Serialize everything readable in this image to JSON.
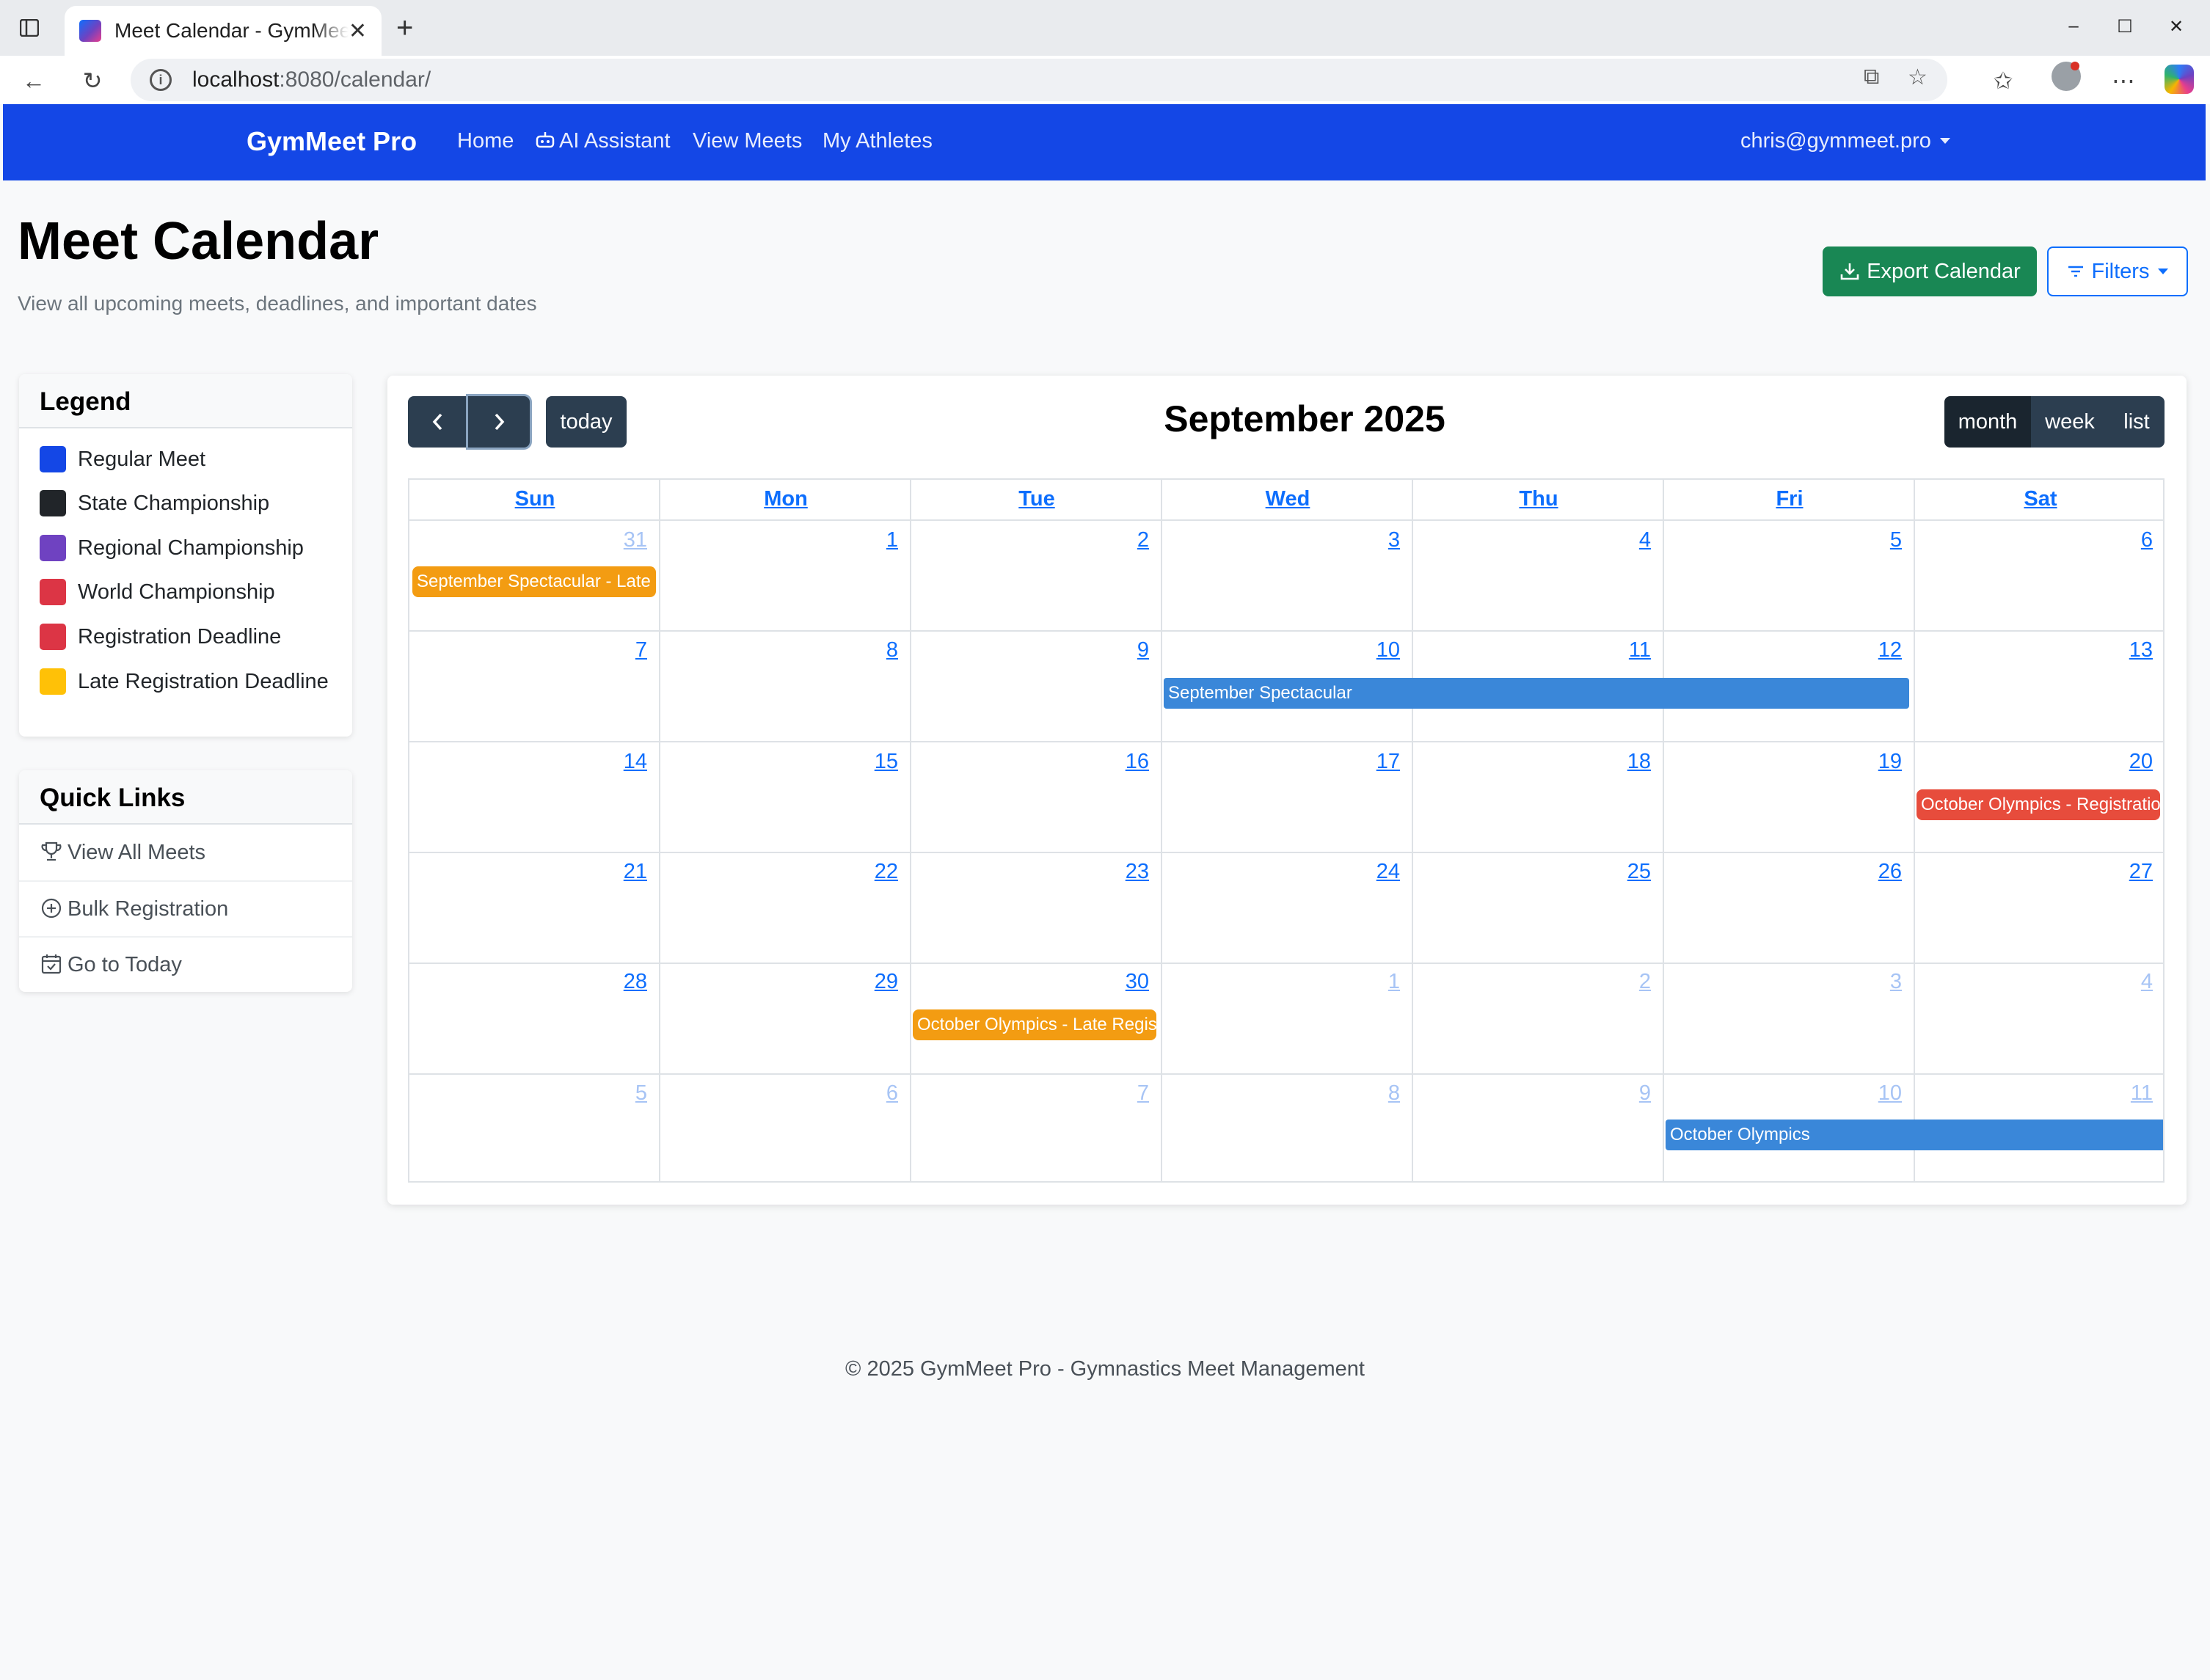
{
  "browser": {
    "tab_title": "Meet Calendar - GymMeet Pro",
    "url_host": "localhost",
    "url_path": ":8080/calendar/"
  },
  "navbar": {
    "brand": "GymMeet Pro",
    "links": {
      "home": "Home",
      "ai_assistant": "AI Assistant",
      "view_meets": "View Meets",
      "my_athletes": "My Athletes"
    },
    "user": "chris@gymmeet.pro"
  },
  "header": {
    "title": "Meet Calendar",
    "subtitle": "View all upcoming meets, deadlines, and important dates",
    "export_label": "Export Calendar",
    "filters_label": "Filters"
  },
  "legend": {
    "title": "Legend",
    "items": [
      {
        "label": "Regular Meet",
        "color": "#1447e6"
      },
      {
        "label": "State Championship",
        "color": "#212529"
      },
      {
        "label": "Regional Championship",
        "color": "#6f42c1"
      },
      {
        "label": "World Championship",
        "color": "#dc3545"
      },
      {
        "label": "Registration Deadline",
        "color": "#dc3545"
      },
      {
        "label": "Late Registration Deadline",
        "color": "#ffc107"
      }
    ]
  },
  "quick_links": {
    "title": "Quick Links",
    "items": [
      {
        "label": "View All Meets",
        "icon": "trophy-icon"
      },
      {
        "label": "Bulk Registration",
        "icon": "plus-circle-icon"
      },
      {
        "label": "Go to Today",
        "icon": "calendar-check-icon"
      }
    ]
  },
  "calendar": {
    "title": "September 2025",
    "today_label": "today",
    "views": {
      "month": "month",
      "week": "week",
      "list": "list"
    },
    "weekdays": [
      "Sun",
      "Mon",
      "Tue",
      "Wed",
      "Thu",
      "Fri",
      "Sat"
    ],
    "weeks": [
      [
        "31",
        "1",
        "2",
        "3",
        "4",
        "5",
        "6"
      ],
      [
        "7",
        "8",
        "9",
        "10",
        "11",
        "12",
        "13"
      ],
      [
        "14",
        "15",
        "16",
        "17",
        "18",
        "19",
        "20"
      ],
      [
        "21",
        "22",
        "23",
        "24",
        "25",
        "26",
        "27"
      ],
      [
        "28",
        "29",
        "30",
        "1",
        "2",
        "3",
        "4"
      ],
      [
        "5",
        "6",
        "7",
        "8",
        "9",
        "10",
        "11"
      ]
    ],
    "events": {
      "e1": "September Spectacular - Late Registration",
      "e2": "September Spectacular",
      "e3": "October Olympics - Registration Deadline",
      "e4": "October Olympics - Late Registration",
      "e5": "October Olympics"
    },
    "event_colors": {
      "late_registration": "#f39c12",
      "meet": "#3a87d9",
      "registration_deadline": "#e74c3c"
    }
  },
  "footer": {
    "text": "© 2025 GymMeet Pro - Gymnastics Meet Management"
  }
}
